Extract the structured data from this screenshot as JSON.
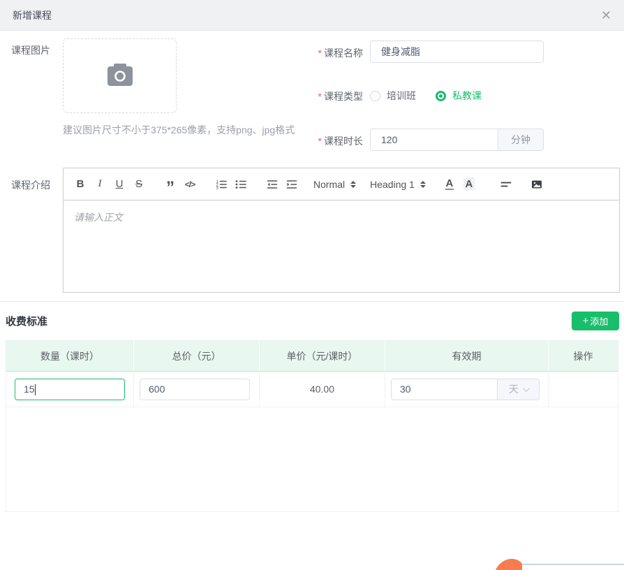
{
  "colors": {
    "green": "#19be6b",
    "red": "#f25a5a",
    "orange": "#f87c4e",
    "line": "#b9c6d0"
  },
  "modal": {
    "title": "新增课程",
    "close_glyph": "✕"
  },
  "form": {
    "required_mark": "*",
    "image": {
      "label": "课程图片",
      "hint": "建议图片尺寸不小于375*265像素，支持png、jpg格式"
    },
    "name": {
      "label": "课程名称",
      "value": "健身减脂"
    },
    "type": {
      "label": "课程类型",
      "options": [
        {
          "label": "培训班"
        },
        {
          "label": "私教课"
        }
      ],
      "selected": "私教课"
    },
    "duration": {
      "label": "课程时长",
      "value": "120",
      "unit": "分钟"
    },
    "intro": {
      "label": "课程介绍",
      "placeholder": "请输入正文",
      "toolbar": {
        "bold": "B",
        "italic": "I",
        "underline": "U",
        "strike": "S",
        "blockquote": "”",
        "code": "</>",
        "size_label": "Normal",
        "heading_label": "Heading 1",
        "color_glyph": "A",
        "background_glyph": "A"
      }
    }
  },
  "pricing": {
    "title": "收费标准",
    "add_icon": "+",
    "add_label": "添加",
    "table": {
      "headers": [
        "数量（课时）",
        "总价（元）",
        "单价（元/课时）",
        "有效期",
        "操作"
      ],
      "row": {
        "quantity": "15",
        "total_price": "600",
        "unit_price": "40.00",
        "validity": "30",
        "validity_unit": "天"
      }
    }
  }
}
